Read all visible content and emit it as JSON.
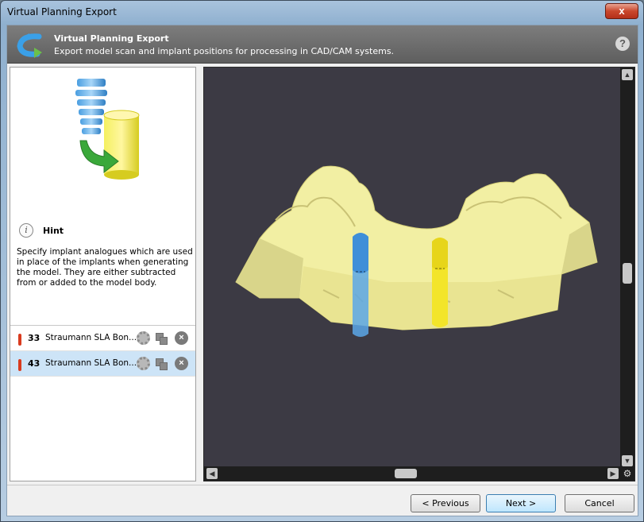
{
  "window": {
    "title": "Virtual Planning Export",
    "close_label": "x"
  },
  "header": {
    "title": "Virtual Planning Export",
    "subtitle": "Export model scan and implant positions for processing in CAD/CAM systems.",
    "help_label": "?"
  },
  "hint": {
    "info_label": "i",
    "title": "Hint",
    "text": "Specify implant analogues which are used in place of the implants when generating the model. They are either subtracted from or added to the model body."
  },
  "implants": [
    {
      "tooth": "33",
      "name": "Straumann SLA Bon...",
      "selected": false,
      "analogue_color": "#5aa7e8"
    },
    {
      "tooth": "43",
      "name": "Straumann SLA Bon...",
      "selected": true,
      "analogue_color": "#f3e52a"
    }
  ],
  "colors": {
    "viewport_bg": "#3c3a44",
    "model": "#f2efa3",
    "warning": "#d93b1f",
    "selection": "#cde4f7"
  },
  "footer": {
    "previous_label": "< Previous",
    "next_label": "Next >",
    "cancel_label": "Cancel"
  }
}
